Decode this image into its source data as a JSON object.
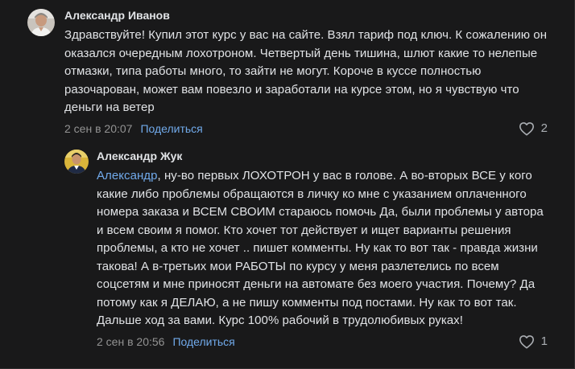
{
  "comments": [
    {
      "author": "Александр Иванов",
      "text": "Здравствуйте! Купил этот курс у вас на сайте. Взял тариф под ключ. К сожалению он оказался очередным лохотроном. Четвертый день тишина, шлют какие то нелепые отмазки, типа работы много, то зайти не могут. Короче в куссе полностью разочарован, может вам повезло и заработали на курсе этом, но я чувствую что деньги на ветер",
      "date": "2 сен в 20:07",
      "share_label": "Поделиться",
      "likes": "2"
    },
    {
      "author": "Александр Жук",
      "mention": "Александр",
      "text": ", ну-во первых ЛОХОТРОН у вас в голове. А во-вторых ВСЕ у кого какие либо проблемы обращаются в личку ко мне с указанием оплаченного номера заказа и ВСЕМ СВОИМ стараюсь помочь Да, были проблемы у автора и всем своим я помог. Кто хочет тот действует и ищет варианты решения проблемы, а кто не хочет .. пишет комменты. Ну как то вот так - правда жизни такова! А в-третьих мои РАБОТЫ по курсу у меня разлетелись по всем соцсетям и мне приносят деньги на автомате без моего участия. Почему? Да потому как я ДЕЛАЮ, а не пишу комменты под постами. Ну как то вот так. Дальше ход за вами. Курс 100% рабочий в трудолюбивых руках!",
      "date": "2 сен в 20:56",
      "share_label": "Поделиться",
      "likes": "1"
    }
  ],
  "icons": {
    "like": "heart-outline-icon"
  },
  "colors": {
    "background": "#19191a",
    "text": "#e1e3e6",
    "secondary": "#939393",
    "link": "#71aaeb"
  }
}
